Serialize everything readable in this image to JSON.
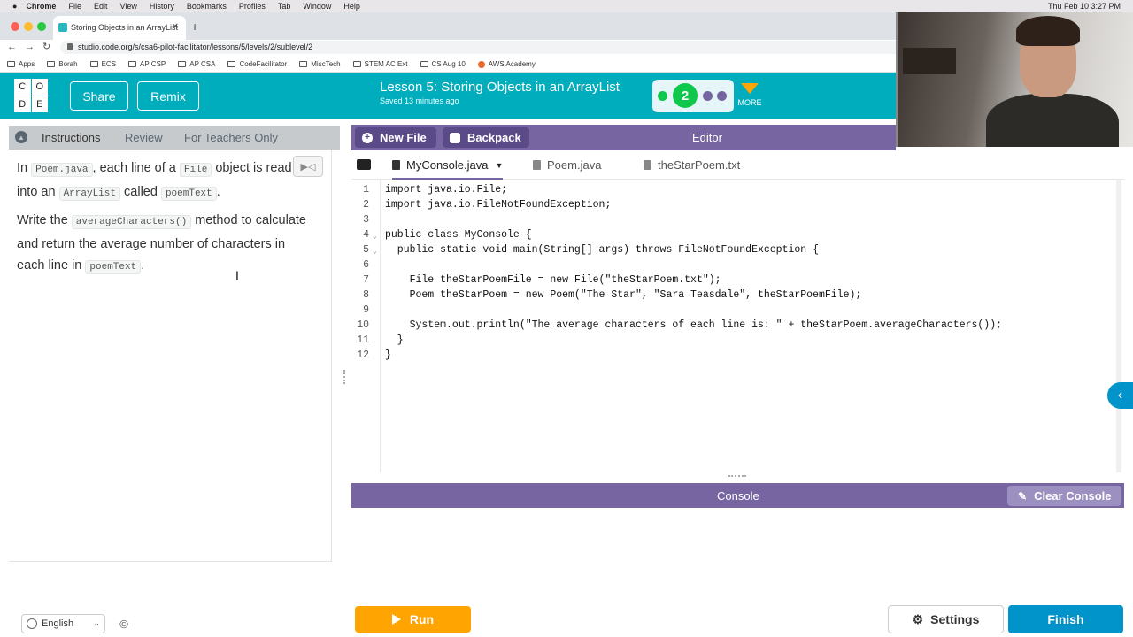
{
  "menubar": {
    "app": "Chrome",
    "items": [
      "File",
      "Edit",
      "View",
      "History",
      "Bookmarks",
      "Profiles",
      "Tab",
      "Window",
      "Help"
    ],
    "clock": "Thu Feb 10  3:27 PM"
  },
  "browser": {
    "tab_title": "Storing Objects in an ArrayList",
    "url": "studio.code.org/s/csa6-pilot-facilitator/lessons/5/levels/2/sublevel/2",
    "bookmarks": [
      "Apps",
      "Borah",
      "ECS",
      "AP CSP",
      "AP CSA",
      "CodeFacilitator",
      "MiscTech",
      "STEM AC Ext",
      "CS Aug 10",
      "AWS Academy"
    ]
  },
  "header": {
    "logo_letters": [
      "C",
      "O",
      "D",
      "E"
    ],
    "share_label": "Share",
    "remix_label": "Remix",
    "lesson_title": "Lesson 5: Storing Objects in an ArrayList",
    "saved_text": "Saved 13 minutes ago",
    "current_level": "2",
    "more_label": "MORE"
  },
  "instructions": {
    "tabs": [
      "Instructions",
      "Review",
      "For Teachers Only"
    ],
    "p1": {
      "t1": "In ",
      "c1": "Poem.java",
      "t2": ", each line of a ",
      "c2": "File",
      "t3": " object is read into an ",
      "c3": "ArrayList",
      "t4": " called ",
      "c4": "poemText",
      "t5": "."
    },
    "p2": {
      "t1": "Write the ",
      "c1": "averageCharacters()",
      "t2": " method to calculate and return the average number of characters in each line in ",
      "c2": "poemText",
      "t3": "."
    }
  },
  "footer": {
    "language": "English"
  },
  "editor": {
    "new_file_label": "New File",
    "backpack_label": "Backpack",
    "title": "Editor",
    "files": [
      "MyConsole.java",
      "Poem.java",
      "theStarPoem.txt"
    ],
    "lines": [
      "import java.io.File;",
      "import java.io.FileNotFoundException;",
      "",
      "public class MyConsole {",
      "  public static void main(String[] args) throws FileNotFoundException {",
      "",
      "    File theStarPoemFile = new File(\"theStarPoem.txt\");",
      "    Poem theStarPoem = new Poem(\"The Star\", \"Sara Teasdale\", theStarPoemFile);",
      "",
      "    System.out.println(\"The average characters of each line is: \" + theStarPoem.averageCharacters());",
      "  }",
      "}"
    ]
  },
  "console": {
    "title": "Console",
    "clear_label": "Clear Console"
  },
  "actions": {
    "run_label": "Run",
    "settings_label": "Settings",
    "finish_label": "Finish"
  },
  "colors": {
    "header_teal": "#00adbc",
    "editor_purple": "#7665a0",
    "run_orange": "#ffa400",
    "finish_blue": "#0094ca",
    "progress_green": "#0ec74b"
  }
}
